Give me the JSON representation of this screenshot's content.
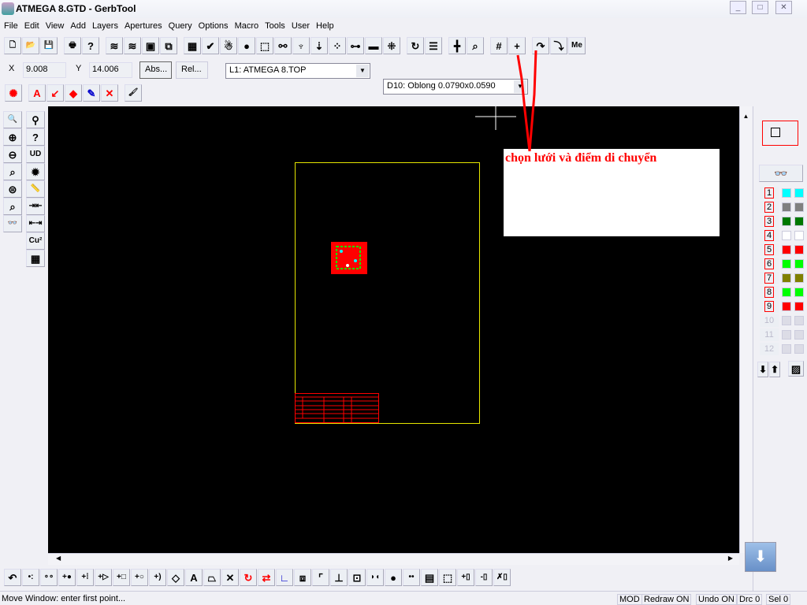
{
  "window": {
    "title": "ATMEGA 8.GTD - GerbTool",
    "minimize": "_",
    "maximize": "□",
    "close": "✕"
  },
  "menu": [
    "File",
    "Edit",
    "View",
    "Add",
    "Layers",
    "Apertures",
    "Query",
    "Options",
    "Macro",
    "Tools",
    "User",
    "Help"
  ],
  "toolbar_main": [
    {
      "name": "new-file-icon",
      "glyph": "🗋"
    },
    {
      "name": "open-folder-icon",
      "glyph": "📂"
    },
    {
      "name": "save-icon",
      "glyph": "💾"
    },
    {
      "sep": true
    },
    {
      "name": "print-icon",
      "glyph": "🖶"
    },
    {
      "name": "help-icon",
      "glyph": "?"
    },
    {
      "sep": true
    },
    {
      "name": "layers-icon",
      "glyph": "≋"
    },
    {
      "name": "layers-highlight-icon",
      "glyph": "≋"
    },
    {
      "name": "display-icon",
      "glyph": "▣"
    },
    {
      "name": "window-zoom-icon",
      "glyph": "⧉"
    },
    {
      "sep": true
    },
    {
      "name": "pad-grid-icon",
      "glyph": "▦"
    },
    {
      "name": "drc-check-icon",
      "glyph": "✔"
    },
    {
      "name": "snowman-icon",
      "glyph": "☃"
    },
    {
      "name": "flash-icon",
      "glyph": "●"
    },
    {
      "name": "select-box-icon",
      "glyph": "⬚"
    },
    {
      "name": "net-icon",
      "glyph": "⚯"
    },
    {
      "name": "probe-icon",
      "glyph": "♆"
    },
    {
      "name": "drop-icon",
      "glyph": "⇣"
    },
    {
      "name": "dots-icon",
      "glyph": "⁘"
    },
    {
      "name": "connect-icon",
      "glyph": "⊶"
    },
    {
      "name": "plate-icon",
      "glyph": "▬"
    },
    {
      "name": "points-icon",
      "glyph": "⁜"
    },
    {
      "sep": true
    },
    {
      "name": "arc-icon",
      "glyph": "↻"
    },
    {
      "name": "color-bars-icon",
      "glyph": "☰"
    },
    {
      "sep": true
    },
    {
      "name": "insert-icon",
      "glyph": "╋"
    },
    {
      "name": "disabled-query-icon",
      "glyph": "⌕"
    },
    {
      "sep": true
    },
    {
      "name": "grid-icon",
      "glyph": "#"
    },
    {
      "name": "snap-point-icon",
      "glyph": "+"
    },
    {
      "sep": true
    },
    {
      "name": "arc-corner-icon",
      "glyph": "↷"
    },
    {
      "name": "square-corner-icon",
      "glyph": "⤵"
    },
    {
      "name": "measure-icon",
      "glyph": "Me"
    }
  ],
  "coords": {
    "x_label": "X",
    "x_value": "9.008",
    "y_label": "Y",
    "y_value": "14.006",
    "abs_button": "Abs...",
    "rel_button": "Rel..."
  },
  "layer_select": "L1: ATMEGA 8.TOP",
  "aperture_select": "D10: Oblong 0.0790x0.0590",
  "toolbar_edit": [
    {
      "name": "highlight-icon",
      "glyph": "✺",
      "color": "#ff0000"
    },
    {
      "sep": true
    },
    {
      "name": "text-icon",
      "glyph": "A",
      "color": "#ff0000"
    },
    {
      "name": "note-icon",
      "glyph": "↙",
      "color": "#ff0000"
    },
    {
      "name": "fill-icon",
      "glyph": "◆",
      "color": "#ff0000"
    },
    {
      "name": "pen-icon",
      "glyph": "✎",
      "color": "#0000cc"
    },
    {
      "name": "delete-icon",
      "glyph": "✕",
      "color": "#ff0000"
    },
    {
      "sep": true
    },
    {
      "name": "paint-icon",
      "glyph": "🖌",
      "color": "#000"
    }
  ],
  "left_tools_1": [
    {
      "name": "zoom-window-icon",
      "glyph": "🔍"
    },
    {
      "name": "zoom-in-icon",
      "glyph": "⊕"
    },
    {
      "name": "zoom-out-icon",
      "glyph": "⊖"
    },
    {
      "name": "zoom-point-icon",
      "glyph": "⌕"
    },
    {
      "name": "zoom-fit-icon",
      "glyph": "⊜"
    },
    {
      "name": "zoom-board-icon",
      "glyph": "⌕"
    },
    {
      "name": "view-glasses-icon",
      "glyph": "👓"
    }
  ],
  "left_tools_2": [
    {
      "name": "find-icon",
      "glyph": "⚲"
    },
    {
      "name": "query-net-icon",
      "glyph": "?"
    },
    {
      "name": "query-dcode-icon",
      "glyph": "UD"
    },
    {
      "name": "sun-icon",
      "glyph": "✹"
    },
    {
      "name": "ruler-icon",
      "glyph": "📏"
    },
    {
      "name": "spacing-icon",
      "glyph": "⇥⇤"
    },
    {
      "name": "pad-spacing-icon",
      "glyph": "⇤⇥"
    },
    {
      "name": "copper-icon",
      "glyph": "Cu²"
    },
    {
      "name": "area-icon",
      "glyph": "▦"
    }
  ],
  "annotation": {
    "text": "chọn lưới và điểm di chuyển",
    "color": "#ff0000"
  },
  "layers": [
    {
      "num": "1",
      "color": "#00ffff"
    },
    {
      "num": "2",
      "color": "#808080"
    },
    {
      "num": "3",
      "color": "#007800"
    },
    {
      "num": "4",
      "color": "#ffffff"
    },
    {
      "num": "5",
      "color": "#ff0000"
    },
    {
      "num": "6",
      "color": "#00ff00"
    },
    {
      "num": "7",
      "color": "#808000"
    },
    {
      "num": "8",
      "color": "#00ff00"
    },
    {
      "num": "9",
      "color": "#ff0000"
    },
    {
      "num": "10",
      "color": "#dcdce6",
      "disabled": true
    },
    {
      "num": "11",
      "color": "#dcdce6",
      "disabled": true
    },
    {
      "num": "12",
      "color": "#dcdce6",
      "disabled": true
    }
  ],
  "bottom_tools": [
    {
      "name": "undo-icon",
      "glyph": "↶"
    },
    {
      "name": "add-via-icon",
      "glyph": "•:"
    },
    {
      "name": "add-dots-icon",
      "glyph": "∘∘"
    },
    {
      "name": "add-pad-icon",
      "glyph": "+●"
    },
    {
      "name": "add-track-icon",
      "glyph": "+⁞"
    },
    {
      "name": "add-flash-icon",
      "glyph": "+▷"
    },
    {
      "name": "add-rect-icon",
      "glyph": "+□"
    },
    {
      "name": "add-circle-icon",
      "glyph": "+○"
    },
    {
      "name": "add-arc-icon",
      "glyph": "+)"
    },
    {
      "name": "add-diamond-icon",
      "glyph": "◇"
    },
    {
      "name": "add-text-icon",
      "glyph": "A"
    },
    {
      "name": "add-polygon-icon",
      "glyph": "⏢"
    },
    {
      "name": "delete-item-icon",
      "glyph": "✕"
    },
    {
      "name": "rotate-icon",
      "glyph": "↻",
      "color": "#ff0000"
    },
    {
      "name": "swap-icon",
      "glyph": "⇄",
      "color": "#ff0000"
    },
    {
      "name": "axis-icon",
      "glyph": "∟",
      "color": "#0000cc"
    },
    {
      "name": "mirror-icon",
      "glyph": "⧈"
    },
    {
      "name": "corner-icon",
      "glyph": "⌜"
    },
    {
      "name": "align-icon",
      "glyph": "⊥"
    },
    {
      "name": "group-icon",
      "glyph": "⊡"
    },
    {
      "name": "merge-pads-icon",
      "glyph": "◗◖"
    },
    {
      "name": "pad-dot-icon",
      "glyph": "●"
    },
    {
      "name": "pad-pair-icon",
      "glyph": "••"
    },
    {
      "name": "report-icon",
      "glyph": "▤"
    },
    {
      "name": "select-item-icon",
      "glyph": "⬚"
    },
    {
      "name": "add-box-icon",
      "glyph": "+▯"
    },
    {
      "name": "remove-box-icon",
      "glyph": "-▯"
    },
    {
      "name": "cancel-box-icon",
      "glyph": "✗▯"
    }
  ],
  "status": {
    "message": "Move Window: enter first point...",
    "mod": "MOD",
    "redraw": "Redraw ON",
    "undo": "Undo ON",
    "drc": "Drc 0",
    "sel": "Sel 0"
  }
}
